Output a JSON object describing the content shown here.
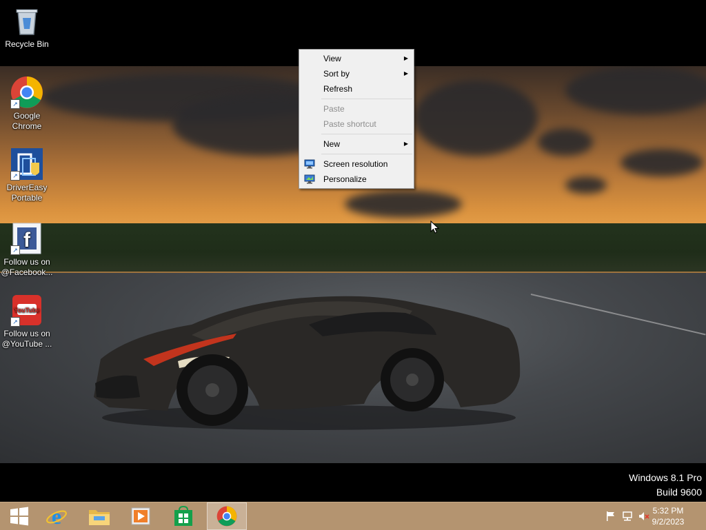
{
  "desktop": {
    "icons": [
      {
        "label": "Recycle Bin",
        "icon": "recycle-bin-icon"
      },
      {
        "label": "Google Chrome",
        "icon": "chrome-icon"
      },
      {
        "label": "DriverEasy Portable",
        "icon": "drivereasy-icon"
      },
      {
        "label": "Follow us on @Facebook...",
        "icon": "facebook-icon"
      },
      {
        "label": "Follow us on @YouTube ...",
        "icon": "youtube-icon"
      }
    ]
  },
  "context_menu": {
    "items": [
      {
        "label": "View",
        "submenu": true,
        "enabled": true
      },
      {
        "label": "Sort by",
        "submenu": true,
        "enabled": true
      },
      {
        "label": "Refresh",
        "submenu": false,
        "enabled": true
      },
      {
        "label": "Paste",
        "submenu": false,
        "enabled": false
      },
      {
        "label": "Paste shortcut",
        "submenu": false,
        "enabled": false
      },
      {
        "label": "New",
        "submenu": true,
        "enabled": true
      },
      {
        "label": "Screen resolution",
        "submenu": false,
        "enabled": true,
        "icon": "display-icon"
      },
      {
        "label": "Personalize",
        "submenu": false,
        "enabled": true,
        "icon": "personalize-icon"
      }
    ],
    "arrow_glyph": "▶"
  },
  "watermark": {
    "line1": "Windows 8.1 Pro",
    "line2": "Build 9600"
  },
  "taskbar": {
    "buttons": [
      {
        "name": "start",
        "icon": "windows-logo-icon"
      },
      {
        "name": "internet-explorer",
        "icon": "ie-icon"
      },
      {
        "name": "file-explorer",
        "icon": "folder-icon"
      },
      {
        "name": "media-player",
        "icon": "media-player-icon"
      },
      {
        "name": "store",
        "icon": "store-icon"
      },
      {
        "name": "chrome",
        "icon": "chrome-icon",
        "active": true
      }
    ],
    "tray": {
      "icons": [
        "action-center-flag-icon",
        "network-icon",
        "volume-muted-icon"
      ],
      "time": "5:32 PM",
      "date": "9/2/2023"
    }
  },
  "colors": {
    "taskbar": "#b49470",
    "menu_bg": "#f0f0f0",
    "menu_disabled_text": "#8d8d8d"
  }
}
